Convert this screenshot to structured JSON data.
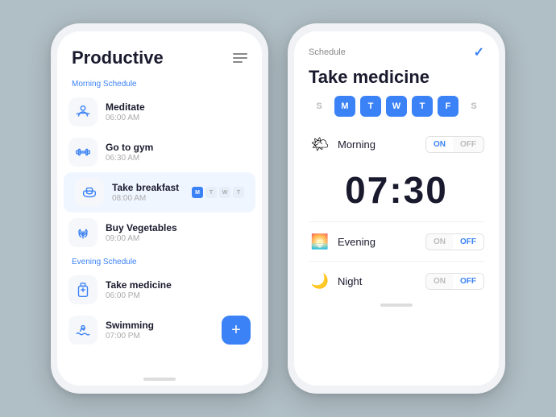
{
  "left_phone": {
    "title": "Productive",
    "morning_label": "Morning Schedule",
    "evening_label": "Evening Schedule",
    "tasks": [
      {
        "name": "Meditate",
        "time": "06:00 AM",
        "icon": "meditate",
        "active": false,
        "has_dots": false
      },
      {
        "name": "Go to gym",
        "time": "06:30 AM",
        "icon": "gym",
        "active": false,
        "has_dots": false
      },
      {
        "name": "Take breakfast",
        "time": "08:00 AM",
        "icon": "breakfast",
        "active": true,
        "has_dots": true
      },
      {
        "name": "Buy Vegetables",
        "time": "09:00 AM",
        "icon": "vegetables",
        "active": false,
        "has_dots": false
      }
    ],
    "evening_tasks": [
      {
        "name": "Take medicine",
        "time": "06:00 PM",
        "icon": "medicine",
        "active": false,
        "has_dots": false
      },
      {
        "name": "Swimming",
        "time": "07:00 PM",
        "icon": "swimming",
        "active": false,
        "has_fab": true
      }
    ],
    "fab_label": "+"
  },
  "right_phone": {
    "header_label": "Schedule",
    "title": "Take medicine",
    "days": [
      {
        "label": "S",
        "active": false
      },
      {
        "label": "M",
        "active": true
      },
      {
        "label": "T",
        "active": true
      },
      {
        "label": "W",
        "active": true
      },
      {
        "label": "T",
        "active": true
      },
      {
        "label": "F",
        "active": true
      },
      {
        "label": "S",
        "active": false
      }
    ],
    "morning": {
      "label": "Morning",
      "on_label": "ON",
      "off_label": "OFF",
      "state": "on"
    },
    "time": "07:30",
    "evening": {
      "label": "Evening",
      "on_label": "ON",
      "off_label": "OFF",
      "state": "off"
    },
    "night": {
      "label": "Night",
      "on_label": "ON",
      "off_label": "OFF",
      "state": "off"
    }
  },
  "colors": {
    "blue": "#3b82f6",
    "text_dark": "#1a1a2e",
    "text_muted": "#aaaaaa",
    "bg": "#b0bec5"
  }
}
